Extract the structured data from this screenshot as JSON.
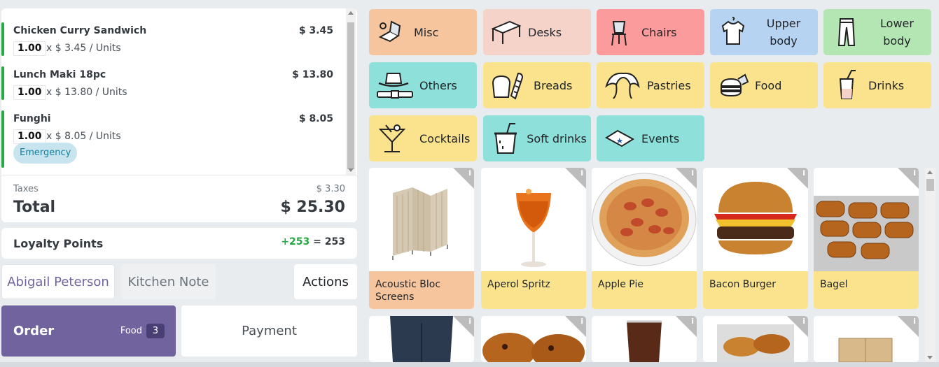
{
  "order_lines": [
    {
      "name": "Chicken Curry Sandwich",
      "price": "$ 3.45",
      "qty": "1.00",
      "unit_text": "x $ 3.45 / Units"
    },
    {
      "name": "Lunch Maki 18pc",
      "price": "$ 13.80",
      "qty": "1.00",
      "unit_text": "x $ 13.80 / Units"
    },
    {
      "name": "Funghi",
      "price": "$ 8.05",
      "qty": "1.00",
      "unit_text": "x $ 8.05 / Units",
      "tag": "Emergency"
    }
  ],
  "summary": {
    "taxes_label": "Taxes",
    "taxes_value": "$ 3.30",
    "total_label": "Total",
    "total_value": "$ 25.30"
  },
  "loyalty": {
    "label": "Loyalty Points",
    "gained": "+253",
    "equals": "=",
    "balance": "253"
  },
  "actions": {
    "customer": "Abigail Peterson",
    "kitchen_note": "Kitchen Note",
    "actions": "Actions",
    "order": "Order",
    "order_category": "Food",
    "order_count": "3",
    "payment": "Payment"
  },
  "categories": [
    {
      "label": "Misc",
      "color": "#f6c59e",
      "icon": "misc-icon"
    },
    {
      "label": "Desks",
      "color": "#f6d3c9",
      "icon": "desk-icon"
    },
    {
      "label": "Chairs",
      "color": "#fc9b9b",
      "icon": "chair-icon"
    },
    {
      "label": "Upper body",
      "color": "#b7d3f2",
      "icon": "shirt-icon"
    },
    {
      "label": "Lower body",
      "color": "#b3e6b3",
      "icon": "pants-icon"
    },
    {
      "label": "Others",
      "color": "#8ee0da",
      "icon": "hat-icon"
    },
    {
      "label": "Breads",
      "color": "#fbe38d",
      "icon": "bread-icon"
    },
    {
      "label": "Pastries",
      "color": "#fbe38d",
      "icon": "croissant-icon"
    },
    {
      "label": "Food",
      "color": "#fbe38d",
      "icon": "burger-icon"
    },
    {
      "label": "Drinks",
      "color": "#fbe38d",
      "icon": "drink-icon"
    },
    {
      "label": "Cocktails",
      "color": "#fbe38d",
      "icon": "cocktail-icon"
    },
    {
      "label": "Soft drinks",
      "color": "#8ee0da",
      "icon": "soda-icon"
    },
    {
      "label": "Events",
      "color": "#8ee0da",
      "icon": "ticket-icon"
    }
  ],
  "products": [
    {
      "name": "Acoustic Bloc Screens",
      "color": "#f6c59e",
      "info": "i"
    },
    {
      "name": "Aperol Spritz",
      "color": "#fbe38d",
      "info": "i"
    },
    {
      "name": "Apple Pie",
      "color": "#fbe38d",
      "info": "i"
    },
    {
      "name": "Bacon Burger",
      "color": "#fbe38d",
      "info": "i"
    },
    {
      "name": "Bagel",
      "color": "#fbe38d",
      "info": "i"
    }
  ],
  "products_row2_info": "i"
}
